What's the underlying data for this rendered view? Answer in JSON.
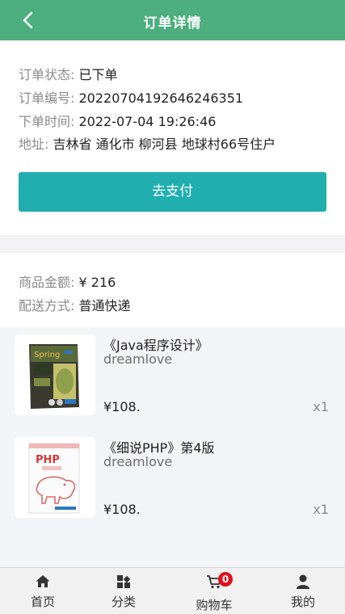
{
  "header": {
    "title": "订单详情",
    "back_icon": "back-arrow-icon"
  },
  "order": {
    "status_label": "订单状态:",
    "status_value": "已下单",
    "number_label": "订单编号:",
    "number_value": "20220704192646246351",
    "time_label": "下单时间:",
    "time_value": "2022-07-04 19:26:46",
    "address_label": "地址:",
    "address_value": "吉林省 通化市 柳河县 地球村66号住户",
    "pay_button": "去支付"
  },
  "summary": {
    "amount_label": "商品金额:",
    "amount_value": "¥ 216",
    "delivery_label": "配送方式:",
    "delivery_value": "普通快递"
  },
  "products": [
    {
      "name": "《Java程序设计》",
      "author": "dreamlove",
      "price": "¥108.",
      "qty": "x1",
      "cover_icon": "spring-book-cover-icon"
    },
    {
      "name": "《细说PHP》第4版",
      "author": "dreamlove",
      "price": "¥108.",
      "qty": "x1",
      "cover_icon": "php-book-cover-icon"
    }
  ],
  "tabbar": {
    "home": "首页",
    "category": "分类",
    "cart": "购物车",
    "cart_badge": "0",
    "mine": "我的"
  },
  "colors": {
    "header": "#4caf7d",
    "pay_button": "#21aeae",
    "badge": "#e0101e"
  }
}
